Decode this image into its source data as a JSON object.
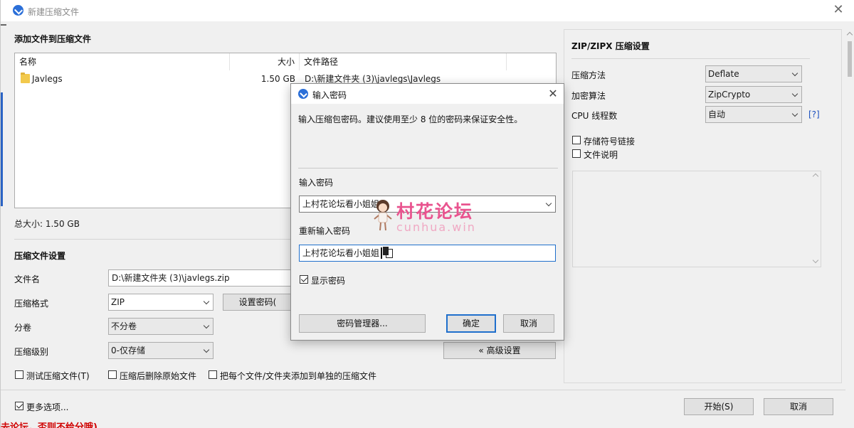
{
  "window": {
    "title": "新建压缩文件"
  },
  "add_files": {
    "heading": "添加文件到压缩文件",
    "columns": [
      "名称",
      "大小",
      "文件路径"
    ],
    "rows": [
      {
        "name": "Javlegs",
        "size": "1.50 GB",
        "path": "D:\\新建文件夹 (3)\\javlegs\\Javlegs",
        "icon": "folder-icon"
      }
    ],
    "total_size": "总大小: 1.50 GB"
  },
  "archive_settings": {
    "heading": "压缩文件设置",
    "filename_label": "文件名",
    "filename_value": "D:\\新建文件夹 (3)\\javlegs.zip",
    "format_label": "压缩格式",
    "format_value": "ZIP",
    "set_password_button": "设置密码(",
    "split_label": "分卷",
    "split_value": "不分卷",
    "level_label": "压缩级别",
    "level_value": "0-仅存储",
    "advanced_button": "« 高级设置",
    "test_archive": "测试压缩文件(T)",
    "delete_after": "压缩后删除原始文件",
    "each_separate": "把每个文件/文件夹添加到单独的压缩文件"
  },
  "zip_settings": {
    "heading": "ZIP/ZIPX 压缩设置",
    "method_label": "压缩方法",
    "method_value": "Deflate",
    "encryption_label": "加密算法",
    "encryption_value": "ZipCrypto",
    "threads_label": "CPU 线程数",
    "threads_value": "自动",
    "help_link": "[?]",
    "store_symlinks": "存储符号链接",
    "file_comment": "文件说明"
  },
  "footer": {
    "more_options": "更多选项...",
    "start_button": "开始(S)",
    "cancel_button": "取消",
    "red_text": "去论坛，否则不给分哦)"
  },
  "password_dialog": {
    "title": "输入密码",
    "message": "输入压缩包密码。建议使用至少 8 位的密码来保证安全性。",
    "enter_label": "输入密码",
    "enter_value": "上村花论坛看小姐姐",
    "reenter_label": "重新输入密码",
    "reenter_value": "上村花论坛看小姐姐",
    "show_password": "显示密码",
    "manager_button": "密码管理器...",
    "ok_button": "确定",
    "cancel_button": "取消"
  },
  "watermark": {
    "text": "村花论坛",
    "sub": "cunhua.win"
  },
  "colors": {
    "accent": "#1f6fcc",
    "watermark": "#e9548f",
    "warning": "#d00000"
  }
}
